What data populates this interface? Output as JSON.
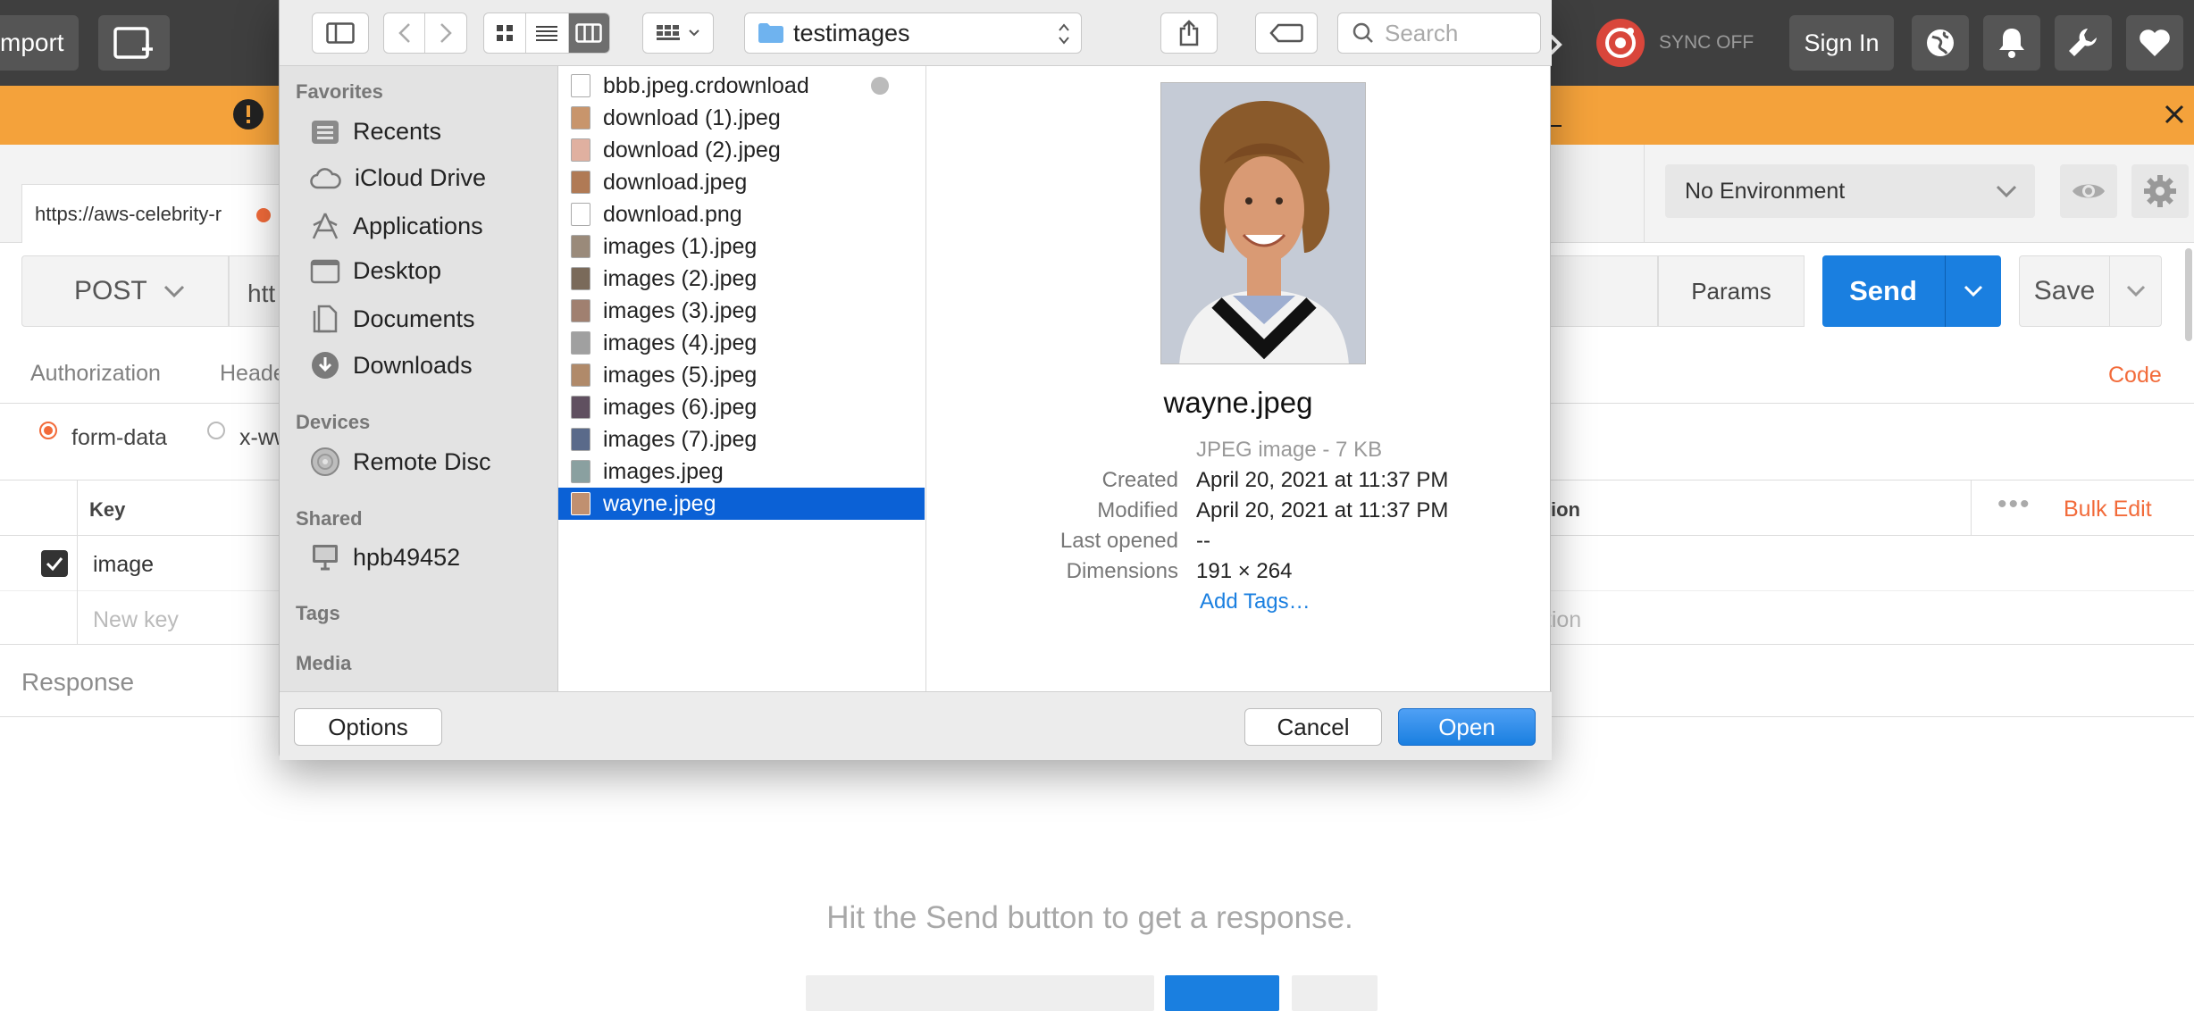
{
  "topbar": {
    "import_label": "mport",
    "sync_label": "SYNC OFF",
    "signin_label": "Sign In"
  },
  "tabs": {
    "url_tab": "https://aws-celebrity-r"
  },
  "environment": {
    "selected": "No Environment"
  },
  "request": {
    "method": "POST",
    "url": "htt",
    "params_label": "Params",
    "send_label": "Send",
    "save_label": "Save"
  },
  "subtabs": {
    "authorization": "Authorization",
    "headers": "Heade",
    "code": "Code"
  },
  "body": {
    "form_data": "form-data",
    "x_www": "x-ww"
  },
  "kv": {
    "key_header": "Key",
    "desc_header": "ion",
    "bulk_edit": "Bulk Edit",
    "row1_key": "image",
    "new_key_placeholder": "New key",
    "desc_placeholder": "ption"
  },
  "response": {
    "label": "Response",
    "hint": "Hit the Send button to get a response."
  },
  "dialog": {
    "folder": "testimages",
    "search_placeholder": "Search",
    "sidebar": {
      "favorites_header": "Favorites",
      "favorites": [
        "Recents",
        "iCloud Drive",
        "Applications",
        "Desktop",
        "Documents",
        "Downloads"
      ],
      "devices_header": "Devices",
      "devices": [
        "Remote Disc"
      ],
      "shared_header": "Shared",
      "shared": [
        "hpb49452"
      ],
      "tags_header": "Tags",
      "media_header": "Media"
    },
    "files": [
      "bbb.jpeg.crdownload",
      "download (1).jpeg",
      "download (2).jpeg",
      "download.jpeg",
      "download.png",
      "images (1).jpeg",
      "images (2).jpeg",
      "images (3).jpeg",
      "images (4).jpeg",
      "images (5).jpeg",
      "images (6).jpeg",
      "images (7).jpeg",
      "images.jpeg",
      "wayne.jpeg"
    ],
    "selected_file": "wayne.jpeg",
    "preview": {
      "name": "wayne.jpeg",
      "kind": "JPEG image - 7 KB",
      "created_label": "Created",
      "created": "April 20, 2021 at 11:37 PM",
      "modified_label": "Modified",
      "modified": "April 20, 2021 at 11:37 PM",
      "last_opened_label": "Last opened",
      "last_opened": "--",
      "dimensions_label": "Dimensions",
      "dimensions": "191 × 264",
      "add_tags": "Add Tags…"
    },
    "options_label": "Options",
    "cancel_label": "Cancel",
    "open_label": "Open"
  },
  "colors": {
    "accent_orange": "#f26b3a",
    "send_blue": "#1a7fe0",
    "selection_blue": "#0b61d6",
    "banner_orange": "#f4a23b"
  }
}
